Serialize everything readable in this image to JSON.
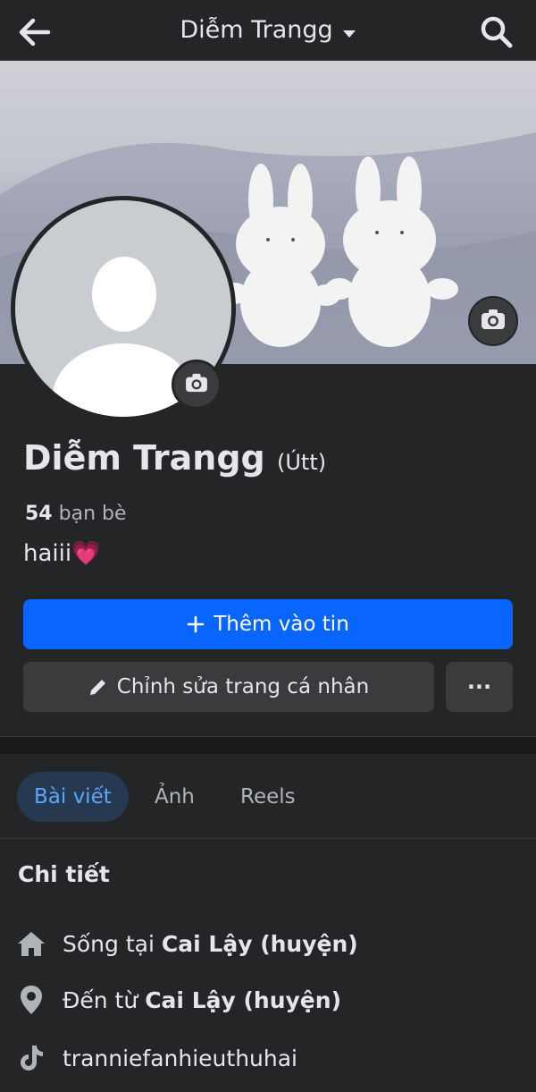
{
  "header": {
    "title": "Diễm Trangg"
  },
  "profile": {
    "name": "Diễm Trangg",
    "nickname": "(Útt)",
    "friends_count": "54",
    "friends_label": "bạn bè",
    "bio": "haiii💗"
  },
  "actions": {
    "add_story": "Thêm vào tin",
    "edit_profile": "Chỉnh sửa trang cá nhân",
    "more": "···"
  },
  "tabs": [
    {
      "label": "Bài viết",
      "active": true
    },
    {
      "label": "Ảnh",
      "active": false
    },
    {
      "label": "Reels",
      "active": false
    }
  ],
  "details": {
    "title": "Chi tiết",
    "lives_prefix": "Sống tại",
    "lives_place": "Cai Lậy (huyện)",
    "from_prefix": "Đến từ",
    "from_place": "Cai Lậy (huyện)",
    "tiktok": "tranniefanhieuthuhai"
  },
  "icons": [
    "back-arrow-icon",
    "caret-down-icon",
    "search-icon",
    "camera-icon",
    "plus-icon",
    "pencil-icon",
    "home-icon",
    "location-pin-icon",
    "tiktok-icon"
  ],
  "colors": {
    "primary": "#0866ff",
    "background": "#242526",
    "active_tab_bg": "#263951",
    "active_tab_text": "#5aa7ff"
  }
}
